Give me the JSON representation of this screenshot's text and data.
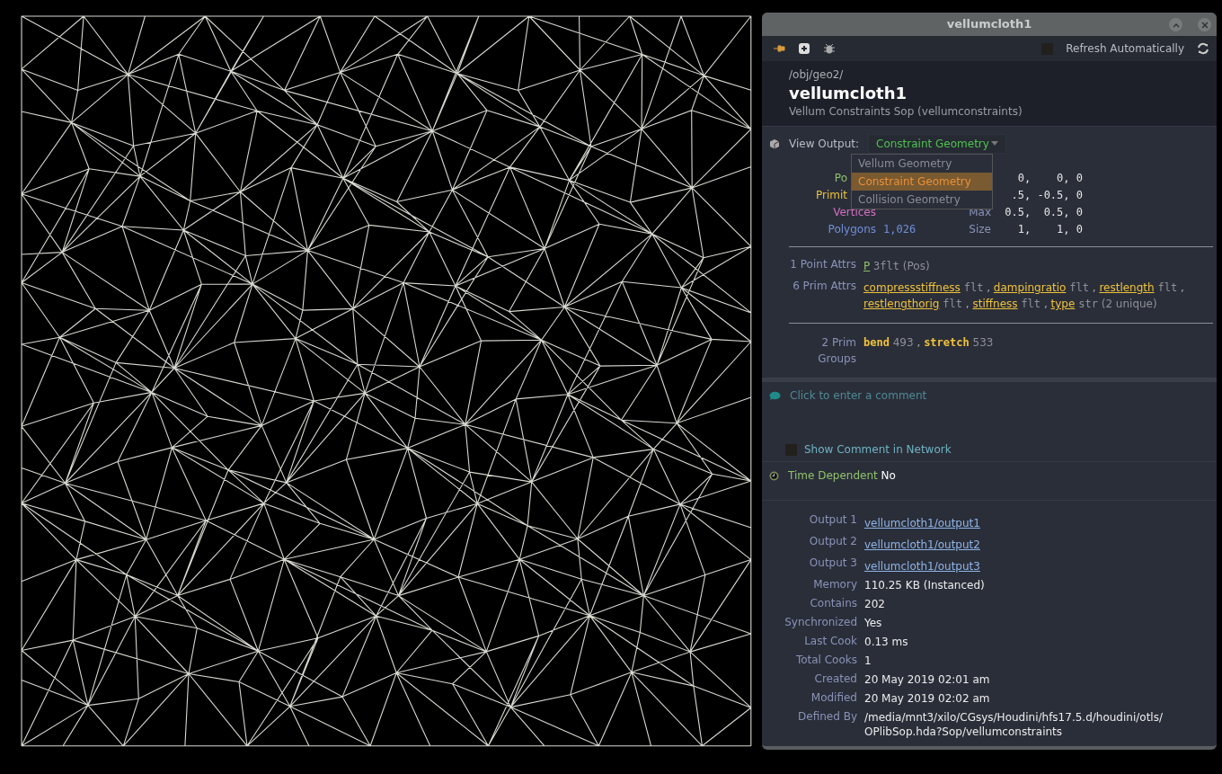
{
  "window": {
    "title": "vellumcloth1"
  },
  "toolbar": {
    "refresh_label": "Refresh Automatically",
    "refresh_checked": false
  },
  "header": {
    "path": "/obj/geo2/",
    "name": "vellumcloth1",
    "type": "Vellum Constraints Sop (vellumconstraints)"
  },
  "view_output": {
    "label": "View Output:",
    "value": "Constraint Geometry",
    "menu": [
      {
        "label": "Vellum Geometry",
        "selected": false
      },
      {
        "label": "Constraint Geometry",
        "selected": true
      },
      {
        "label": "Collision Geometry",
        "selected": false
      }
    ]
  },
  "stats": [
    {
      "label": "Po",
      "color": "#8fc26a",
      "right_value": "0,    0, 0"
    },
    {
      "label": "Primit",
      "color": "#e8c23a",
      "right_value": ".5, -0.5, 0"
    },
    {
      "label": "Vertices",
      "color": "#d36fc0",
      "right_label": "Max",
      "right_value": "0.5,  0.5, 0"
    },
    {
      "label": "Polygons",
      "color": "#6f8fd8",
      "value": "1,026",
      "right_label": "Size",
      "right_value": "1,    1, 0"
    }
  ],
  "attributes": [
    {
      "label": "1 Point Attrs",
      "items": [
        {
          "name": "P",
          "color": "#8fc26a",
          "type": "3flt",
          "note": "(Pos)"
        }
      ]
    },
    {
      "label": "6 Prim Attrs",
      "separator": ",",
      "items": [
        {
          "name": "compressstiffness",
          "color": "#f0c23a",
          "type": "flt"
        },
        {
          "name": "dampingratio",
          "color": "#f0c23a",
          "type": "flt"
        },
        {
          "name": "restlength",
          "color": "#f0c23a",
          "type": "flt"
        },
        {
          "name": "restlengthorig",
          "color": "#f0c23a",
          "type": "flt"
        },
        {
          "name": "stiffness",
          "color": "#f0c23a",
          "type": "flt"
        },
        {
          "name": "type",
          "color": "#f0c23a",
          "type": "str",
          "note": "(2 unique)"
        }
      ]
    }
  ],
  "groups": {
    "label": "2 Prim Groups",
    "separator": ",",
    "items": [
      {
        "name": "bend",
        "count": "493"
      },
      {
        "name": "stretch",
        "count": "533"
      }
    ]
  },
  "comment": {
    "placeholder": "Click to enter a comment",
    "show_label": "Show Comment in Network",
    "show_checked": false
  },
  "time_dependent": {
    "label": "Time Dependent",
    "value": "No"
  },
  "info": [
    {
      "label": "Output 1",
      "value": "vellumcloth1/output1",
      "kind": "link"
    },
    {
      "label": "Output 2",
      "value": "vellumcloth1/output2",
      "kind": "link"
    },
    {
      "label": "Output 3",
      "value": "vellumcloth1/output3",
      "kind": "link"
    },
    {
      "label": "Memory",
      "value": "110.25 KB (Instanced)",
      "kind": "text"
    },
    {
      "label": "Contains",
      "value": "202",
      "kind": "text"
    },
    {
      "label": "Synchronized",
      "value": "Yes",
      "kind": "text"
    },
    {
      "label": "Last Cook",
      "value": "0.13 ms",
      "kind": "text"
    },
    {
      "label": "Total Cooks",
      "value": "1",
      "kind": "text"
    },
    {
      "label": "Created",
      "value": "20 May 2019 02:01 am",
      "kind": "text"
    },
    {
      "label": "Modified",
      "value": "20 May 2019 02:02 am",
      "kind": "text"
    },
    {
      "label": "Defined By",
      "value": "/media/mnt3/xilo/CGsys/Houdini/hfs17.5.d/houdini/otls/ OPlibSop.hda?Sop/vellumconstraints",
      "kind": "text"
    }
  ]
}
